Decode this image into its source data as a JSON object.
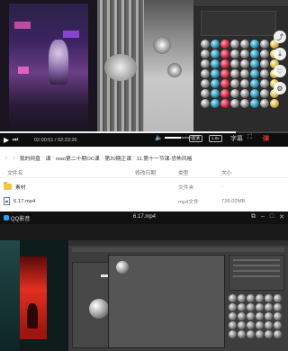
{
  "player": {
    "time": "02:00:51 / 02:23:26",
    "quality_label": "超清",
    "speed_label": "倍速",
    "speed_value": "1.0x",
    "subtitle_label": "字幕",
    "progress_fraction": 0.82,
    "volume_fraction": 0.6,
    "side_icons": [
      "share-icon",
      "download-icon",
      "like-icon",
      "settings-icon"
    ],
    "brand_color": "#e8382d"
  },
  "explorer": {
    "breadcrumb": [
      "我的网盘",
      "课",
      "niao第二十期OC课",
      "第20期正课",
      "11.第十一节课-恐怖风格"
    ],
    "columns": {
      "name": "文件名",
      "date": "修改日期",
      "type": "类型",
      "size": "大小"
    },
    "rows": [
      {
        "name": "素材",
        "date": "",
        "type": "文件夹",
        "size": "-"
      },
      {
        "name": "6.17.mp4",
        "date": "",
        "type": "mp4文件",
        "size": "736.02MB"
      }
    ]
  },
  "qq_player": {
    "app_name": "QQ影音",
    "file_title": "6.17.mp4",
    "accent_color": "#1ea5ff"
  }
}
